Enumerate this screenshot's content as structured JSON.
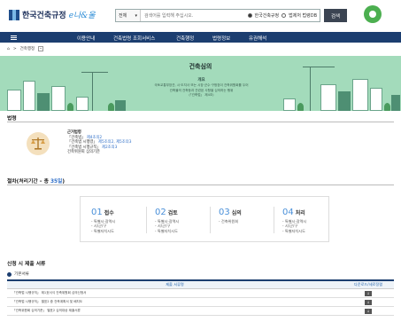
{
  "header": {
    "logo_text": "한국건축규정",
    "logo_suffix": "e나&울",
    "search_select": "전체",
    "search_placeholder": "검색어를 입력해 주십시오.",
    "radio_1": "한국건축규정",
    "radio_2": "법제처 법령DB",
    "search_button": "검색"
  },
  "nav": {
    "items": [
      "이용안내",
      "건축법령 조회서비스",
      "건축행정",
      "법령정보",
      "유권해석"
    ]
  },
  "breadcrumb": {
    "home": "⌂",
    "current": "건축행정"
  },
  "banner": {
    "title": "건축심의",
    "note_title": "개요",
    "note_lines": [
      "국토교통부장관, 시·도지사 또는 시장·군수·구청장이 건축위원회를 두어",
      "건축물의 건축등과 관련된 사항을 심의하는 행위",
      "(「건축법」 제4조)"
    ]
  },
  "law": {
    "section_title": "법령",
    "list_title": "근거법령",
    "lines": [
      {
        "label": "「건축법」 ",
        "link": "제4조의2"
      },
      {
        "label": "「건축법 시행령」 ",
        "link": "제5조의2, 제5조의3"
      },
      {
        "label": "「건축법 시행규칙」 ",
        "link": "제2조의3"
      },
      {
        "label": "건축위원회 심의기준",
        "link": ""
      }
    ]
  },
  "process": {
    "section_title": "절차(처리기간 – 총 ",
    "days": "35일",
    "close": ")",
    "steps": [
      {
        "num": "01",
        "label": "접수",
        "items": [
          "- 특별시·광역시",
          "- 시/군/구",
          "- 특별자치시도"
        ]
      },
      {
        "num": "02",
        "label": "검토",
        "items": [
          "- 특별시·광역시",
          "- 시/군/구",
          "- 특별자치시도"
        ]
      },
      {
        "num": "03",
        "label": "심의",
        "items": [
          "- 건축위원회"
        ]
      },
      {
        "num": "04",
        "label": "처리",
        "items": [
          "- 특별시·광역시",
          "- 시/군/구",
          "- 특별자치시도"
        ]
      }
    ]
  },
  "documents": {
    "section_title": "신청 시 제출 서류",
    "sub_title": "기본서류",
    "col_name": "제출 서류명",
    "col_download": "다운로드/세로정렬",
    "rows": [
      "「건축법 시행규칙」 제1호서식 건축위원회 심의신청서",
      "「건축법 시행규칙」 별표2 중 건축계획서 및 배치도",
      "「건축위원회 심의기준」 별표2 심의대상 제출서류"
    ]
  },
  "colors": {
    "nav": "#1c3e70",
    "banner": "#a3dbbb",
    "accent": "#4a90d9",
    "link": "#3170c9"
  }
}
